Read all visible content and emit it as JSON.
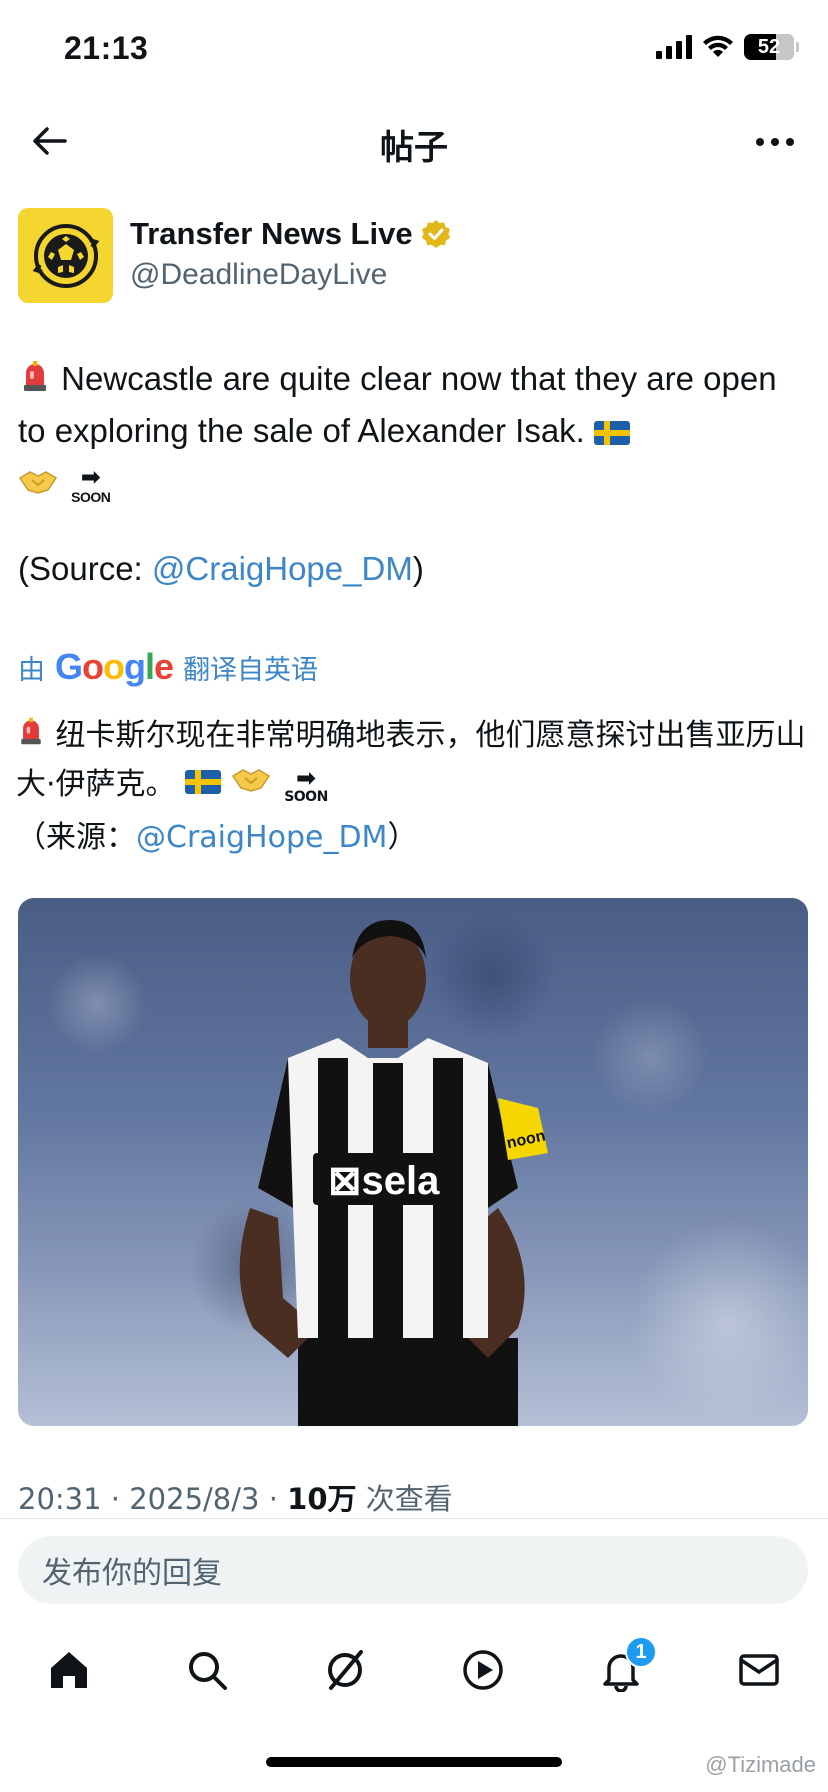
{
  "status": {
    "time": "21:13",
    "battery": "52"
  },
  "header": {
    "title": "帖子"
  },
  "author": {
    "name": "Transfer News Live",
    "handle": "@DeadlineDayLive"
  },
  "tweet": {
    "text": "Newcastle are quite clear now that they are open to exploring the sale of Alexander Isak.",
    "source_prefix": "(Source: ",
    "source_mention": "@CraigHope_DM",
    "source_suffix": ")",
    "soon_label": "SOON"
  },
  "translation": {
    "by_label": "由",
    "google_label": "Google",
    "from_label": "翻译自英语",
    "text": "纽卡斯尔现在非常明确地表示，他们愿意探讨出售亚历山大·伊萨克。",
    "source_prefix": "（来源：",
    "source_mention": "@CraigHope_DM",
    "source_suffix": "）"
  },
  "image": {
    "sponsor": "sela",
    "sleeve": "noon"
  },
  "meta": {
    "time": "20:31",
    "date": "2025/8/3",
    "views_count": "10万",
    "views_label": "次查看"
  },
  "reply": {
    "placeholder": "发布你的回复"
  },
  "tabs": {
    "notifications_badge": "1"
  },
  "watermark": "@Tizimade",
  "colors": {
    "link": "#3d87c6",
    "avatar_bg": "#f5d530",
    "badge": "#1d9bf0"
  }
}
